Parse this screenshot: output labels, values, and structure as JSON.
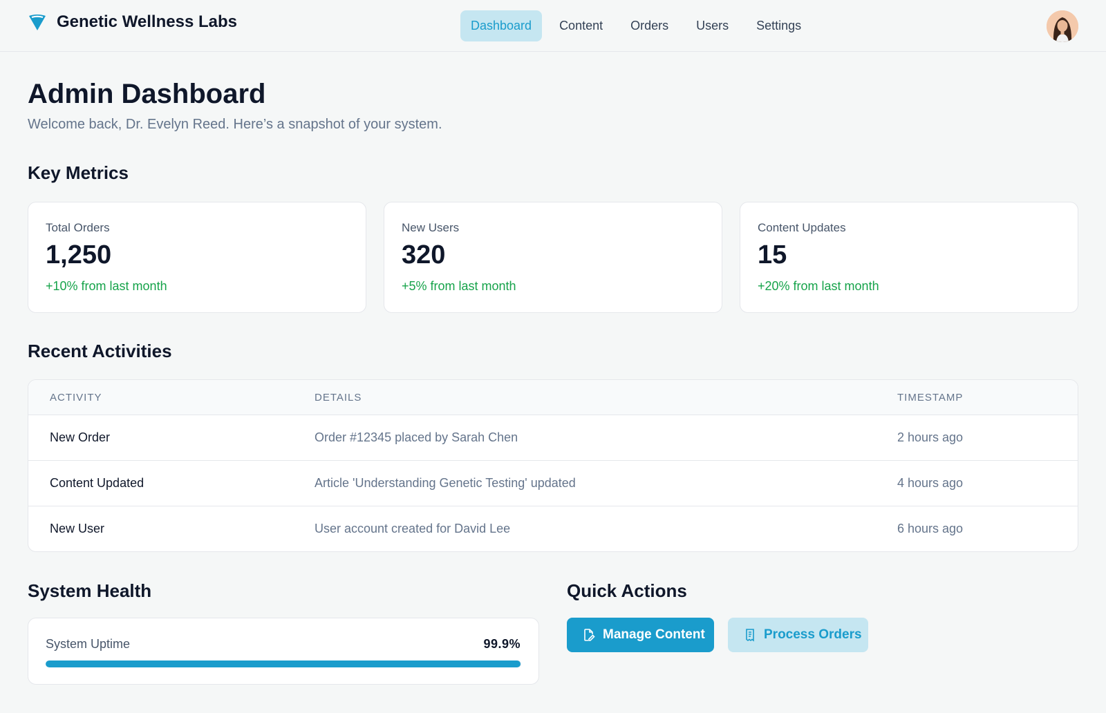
{
  "header": {
    "brand_name": "Genetic Wellness Labs",
    "brand_icon": "dna-shield-icon",
    "nav": [
      {
        "label": "Dashboard",
        "active": true
      },
      {
        "label": "Content",
        "active": false
      },
      {
        "label": "Orders",
        "active": false
      },
      {
        "label": "Users",
        "active": false
      },
      {
        "label": "Settings",
        "active": false
      }
    ],
    "avatar_icon": "user-avatar"
  },
  "page": {
    "title": "Admin Dashboard",
    "subtitle": "Welcome back, Dr. Evelyn Reed. Here’s a snapshot of your system."
  },
  "key_metrics": {
    "title": "Key Metrics",
    "cards": [
      {
        "label": "Total Orders",
        "value": "1,250",
        "change": "+10% from last month"
      },
      {
        "label": "New Users",
        "value": "320",
        "change": "+5% from last month"
      },
      {
        "label": "Content Updates",
        "value": "15",
        "change": "+20% from last month"
      }
    ]
  },
  "recent_activities": {
    "title": "Recent Activities",
    "columns": [
      "ACTIVITY",
      "DETAILS",
      "TIMESTAMP"
    ],
    "rows": [
      {
        "activity": "New Order",
        "details": "Order #12345 placed by Sarah Chen",
        "timestamp": "2 hours ago"
      },
      {
        "activity": "Content Updated",
        "details": "Article 'Understanding Genetic Testing' updated",
        "timestamp": "4 hours ago"
      },
      {
        "activity": "New User",
        "details": "User account created for David Lee",
        "timestamp": "6 hours ago"
      }
    ]
  },
  "system_health": {
    "title": "System Health",
    "uptime_label": "System Uptime",
    "uptime_value": "99.9%",
    "uptime_fraction": 0.999
  },
  "quick_actions": {
    "title": "Quick Actions",
    "manage_content": {
      "label": "Manage Content",
      "icon": "edit-document-icon"
    },
    "process_orders": {
      "label": "Process Orders",
      "icon": "receipt-icon"
    }
  },
  "colors": {
    "accent": "#1a9ccc",
    "accent_light": "#c5e6f1",
    "positive": "#16a34a",
    "background": "#f5f7f7"
  }
}
